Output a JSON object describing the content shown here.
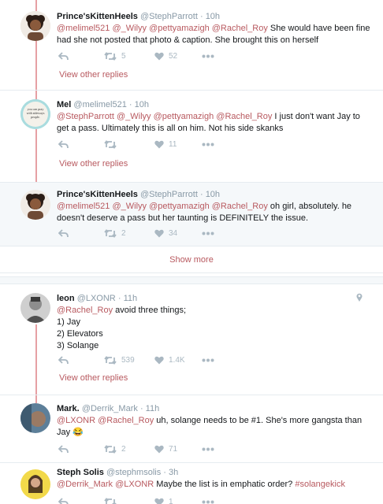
{
  "tweets": [
    {
      "name": "Prince'sKittenHeels",
      "handle": "@StephParrott",
      "sep": "·",
      "time": "10h",
      "text_parts": [
        "@melimel521",
        " ",
        "@_Wilyy",
        " ",
        "@pettyamazigh",
        " ",
        "@Rachel_Roy",
        " She would have been fine had she not posted that photo & caption. She brought this on herself"
      ],
      "retweets": "5",
      "likes": "52",
      "view_other_replies": "View other replies"
    },
    {
      "name": "Mel",
      "handle": "@melimel521",
      "sep": "·",
      "time": "10h",
      "avatar_text": "you can pray with sideways people.",
      "text_parts": [
        "@StephParrott",
        " ",
        "@_Wilyy",
        " ",
        "@pettyamazigh",
        " ",
        "@Rachel_Roy",
        " I just don't want Jay to get a pass. Ultimately this is all on him. Not his side skanks"
      ],
      "retweets": "",
      "likes": "11",
      "view_other_replies": "View other replies"
    },
    {
      "name": "Prince'sKittenHeels",
      "handle": "@StephParrott",
      "sep": "·",
      "time": "10h",
      "text_parts": [
        "@melimel521",
        " ",
        "@_Wilyy",
        " ",
        "@pettyamazigh",
        " ",
        "@Rachel_Roy",
        " oh girl, absolutely. he doesn't deserve a pass but her taunting is DEFINITELY the issue."
      ],
      "retweets": "2",
      "likes": "34"
    },
    {
      "name": "leon",
      "handle": "@LXONR",
      "sep": "·",
      "time": "11h",
      "text_parts": [
        "@Rachel_Roy",
        " avoid three things;"
      ],
      "lines": [
        "1) Jay",
        "2) Elevators",
        "3) Solange"
      ],
      "retweets": "539",
      "likes": "1.4K",
      "view_other_replies": "View other replies"
    },
    {
      "name": "Mark.",
      "handle": "@Derrik_Mark",
      "sep": "·",
      "time": "11h",
      "text_parts": [
        "@LXONR",
        " ",
        "@Rachel_Roy",
        " uh, solange needs to be #1. She's more gangsta than Jay ",
        "😂"
      ],
      "retweets": "2",
      "likes": "71"
    },
    {
      "name": "Steph Solis",
      "handle": "@stephmsolis",
      "sep": "·",
      "time": "3h",
      "text_parts": [
        "@Derrik_Mark",
        " ",
        "@LXONR",
        " Maybe the list is in emphatic order? ",
        "#solangekick"
      ],
      "retweets": "",
      "likes": "1"
    }
  ],
  "show_more": "Show more",
  "colors": {
    "link": "#b8595f",
    "thread": "#e6a0a4",
    "icon": "#aab8c2",
    "highlight": "#f5f8fa"
  },
  "icons": [
    "reply-icon",
    "retweet-icon",
    "heart-icon",
    "more-icon",
    "location-pin-icon"
  ]
}
